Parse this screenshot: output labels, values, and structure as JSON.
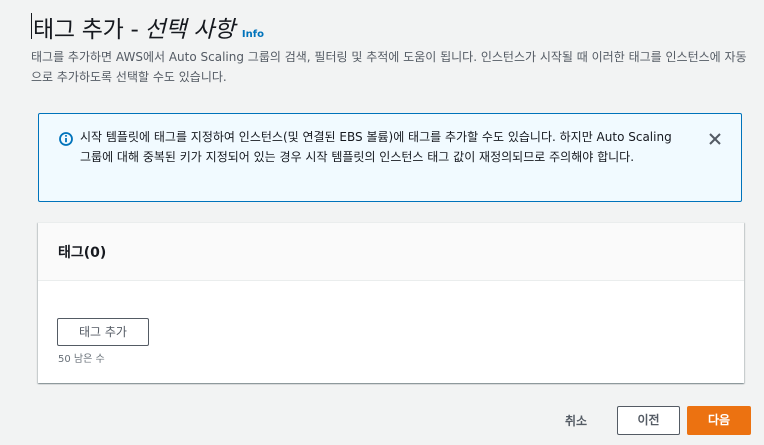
{
  "header": {
    "title": "태그 추가 -",
    "subtitle": "선택 사항",
    "info_link": "Info",
    "description": "태그를 추가하면 AWS에서 Auto Scaling 그룹의 검색, 필터링 및 추적에 도움이 됩니다. 인스턴스가 시작될 때 이러한 태그를 인스턴스에 자동으로 추가하도록 선택할 수도 있습니다."
  },
  "alert": {
    "type": "info",
    "icon": "info-circle-icon",
    "message": "시작 템플릿에 태그를 지정하여 인스턴스(및 연결된 EBS 볼륨)에 태그를 추가할 수도 있습니다. 하지만 Auto Scaling 그룹에 대해 중복된 키가 지정되어 있는 경우 시작 템플릿의 인스턴스 태그 값이 재정의되므로 주의해야 합니다.",
    "close_icon": "close-icon"
  },
  "tags_panel": {
    "title": "태그(0)",
    "add_button": "태그 추가",
    "remaining": "50 남은 수"
  },
  "footer": {
    "cancel": "취소",
    "previous": "이전",
    "next": "다음"
  },
  "colors": {
    "accent": "#0073bb",
    "primary_button": "#ec7211",
    "background": "#f2f3f3",
    "alert_background": "#f1faff"
  }
}
